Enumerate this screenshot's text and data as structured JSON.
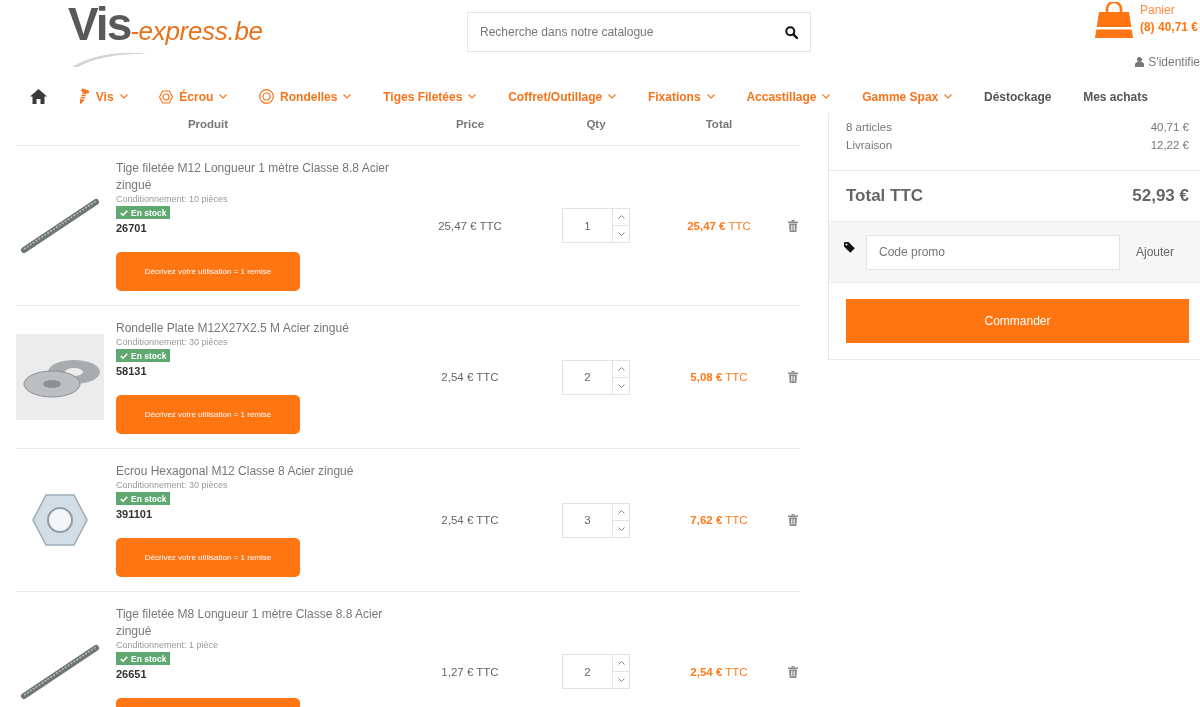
{
  "header": {
    "logo": {
      "primary": "Vis",
      "secondary": "-express.be"
    },
    "search": {
      "placeholder": "Recherche dans notre catalogue"
    },
    "cart": {
      "label": "Panier",
      "summary": "(8) 40,71 €"
    },
    "login": "S'identifie"
  },
  "nav": [
    {
      "kind": "home",
      "dropdown": false
    },
    {
      "kind": "screw",
      "label": "Vis",
      "dropdown": true
    },
    {
      "kind": "nut",
      "label": "Écrou",
      "dropdown": true
    },
    {
      "kind": "washer",
      "label": "Rondelles",
      "dropdown": true
    },
    {
      "kind": "category",
      "label": "Tiges Filetées",
      "dropdown": true
    },
    {
      "kind": "category",
      "label": "Coffret/Outillage",
      "dropdown": true
    },
    {
      "kind": "category",
      "label": "Fixations",
      "dropdown": true
    },
    {
      "kind": "category",
      "label": "Accastillage",
      "dropdown": true
    },
    {
      "kind": "category",
      "label": "Gamme Spax",
      "dropdown": true
    },
    {
      "kind": "page",
      "label": "Déstockage",
      "dropdown": false
    },
    {
      "kind": "page",
      "label": "Mes achats",
      "dropdown": false
    }
  ],
  "cart_table": {
    "columns": [
      "Produit",
      "Price",
      "Qty",
      "Total"
    ],
    "rows": [
      {
        "kind": "rod",
        "name": "Tige filetée M12 Longueur 1 mètre Classe 8.8 Acier zingué",
        "packaging": "Conditionnement: 10 pièces",
        "stock": {
          "label": "En stock",
          "available": true
        },
        "sku": "26701",
        "has_action": true,
        "action_label": "Décrivez votre utilisation = 1 remise",
        "price": "25,47 € TTC",
        "quantity": "1",
        "total": "**25,47 €** TTC"
      },
      {
        "kind": "washer",
        "name": "Rondelle Plate M12X27X2.5 M Acier zingué",
        "packaging": "Conditionnement: 30 pièces",
        "stock": {
          "label": "En stock",
          "available": true
        },
        "sku": "58131",
        "has_action": true,
        "action_label": "Décrivez votre utilisation = 1 remise",
        "price": "2,54 € TTC",
        "quantity": "2",
        "total": "**5,08 €** TTC"
      },
      {
        "kind": "nut",
        "name": "Ecrou Hexagonal M12 Classe 8 Acier zingué",
        "packaging": "Conditionnement: 30 pièces",
        "stock": {
          "label": "En stock",
          "available": true
        },
        "sku": "391101",
        "has_action": true,
        "action_label": "Décrivez votre utilisation = 1 remise",
        "price": "2,54 € TTC",
        "quantity": "3",
        "total": "**7,62 €** TTC"
      },
      {
        "kind": "rod",
        "name": "Tige filetée M8 Longueur 1 mètre Classe 8.8 Acier zingué",
        "packaging": "Conditionnement: 1 pièce",
        "stock": {
          "label": "En stock",
          "available": true
        },
        "sku": "26651",
        "has_action": true,
        "price": "1,27 € TTC",
        "quantity": "2",
        "total": "**2,54 €** TTC"
      }
    ]
  },
  "summary": {
    "lines": [
      {
        "label": "8 articles",
        "value": "40,71 €"
      },
      {
        "label": "Livraison",
        "value": "12,22 €"
      }
    ],
    "total": {
      "label": "Total TTC",
      "value": "52,93 €"
    },
    "promo": {
      "placeholder": "Code promo",
      "button": "Ajouter"
    },
    "checkout": "Commander"
  }
}
